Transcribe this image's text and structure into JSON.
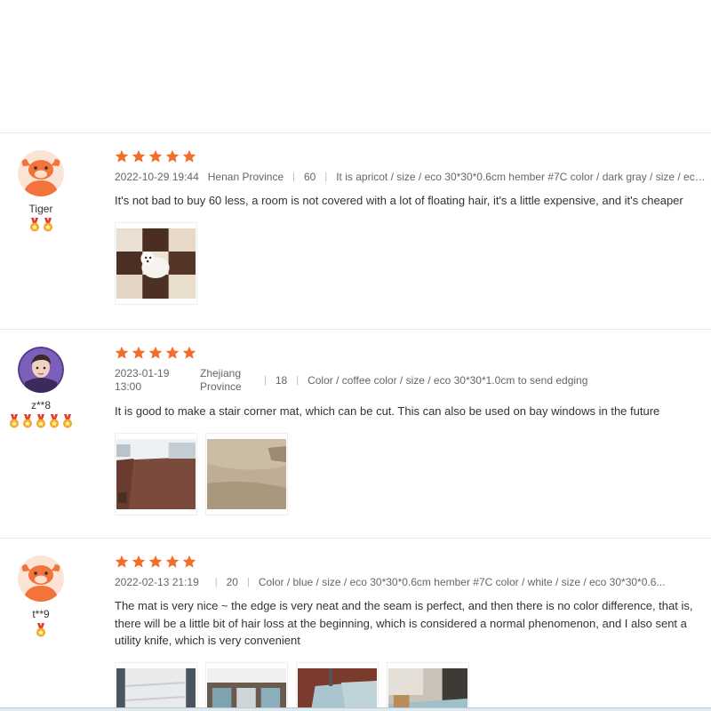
{
  "reviews": [
    {
      "user": {
        "name": "Tiger",
        "avatar": "ox-avatar-icon",
        "medal_count": 2
      },
      "rating": 5,
      "date": "2022-10-29 19:44",
      "location": "Henan Province",
      "likes": "60",
      "sku": "It is apricot / size / eco 30*30*0.6cm hember #7C color / dark gray / size / eco 30*30*...",
      "text": "It's not bad to buy 60 less, a room is not covered with a lot of floating hair, it's a little expensive, and it's cheaper",
      "photos": [
        "dog-on-mat-photo"
      ]
    },
    {
      "user": {
        "name": "z**8",
        "avatar": "person-avatar-icon",
        "medal_count": 5
      },
      "rating": 5,
      "date": "2023-01-19 13:00",
      "location": "Zhejiang Province",
      "likes": "18",
      "sku": "Color / coffee color / size / eco 30*30*1.0cm to send edging",
      "text": "It is good to make a stair corner mat, which can be cut. This can also be used on bay windows in the future",
      "photos": [
        "room-mat-photo",
        "carpet-closeup-photo"
      ]
    },
    {
      "user": {
        "name": "t**9",
        "avatar": "ox-avatar-icon",
        "medal_count": 1
      },
      "rating": 5,
      "date": "2022-02-13 21:19",
      "location": "",
      "likes": "20",
      "sku": "Color / blue / size / eco 30*30*0.6cm hember #7C color / white / size / eco 30*30*0.6...",
      "text": "The mat is very nice ~ the edge is very neat and the seam is perfect, and then there is no color difference, that is, there will be a little bit of hair loss at the beginning, which is considered a normal phenomenon, and I also sent a utility knife, which is very convenient",
      "photos": [
        "white-mat-stack-photo",
        "mat-tiles-photo",
        "blue-mat-floor-photo",
        "room-blue-mat-photo"
      ]
    }
  ],
  "colors": {
    "star": "#f36d2a",
    "medal": "#f5a623",
    "ox": "#f2743a"
  }
}
